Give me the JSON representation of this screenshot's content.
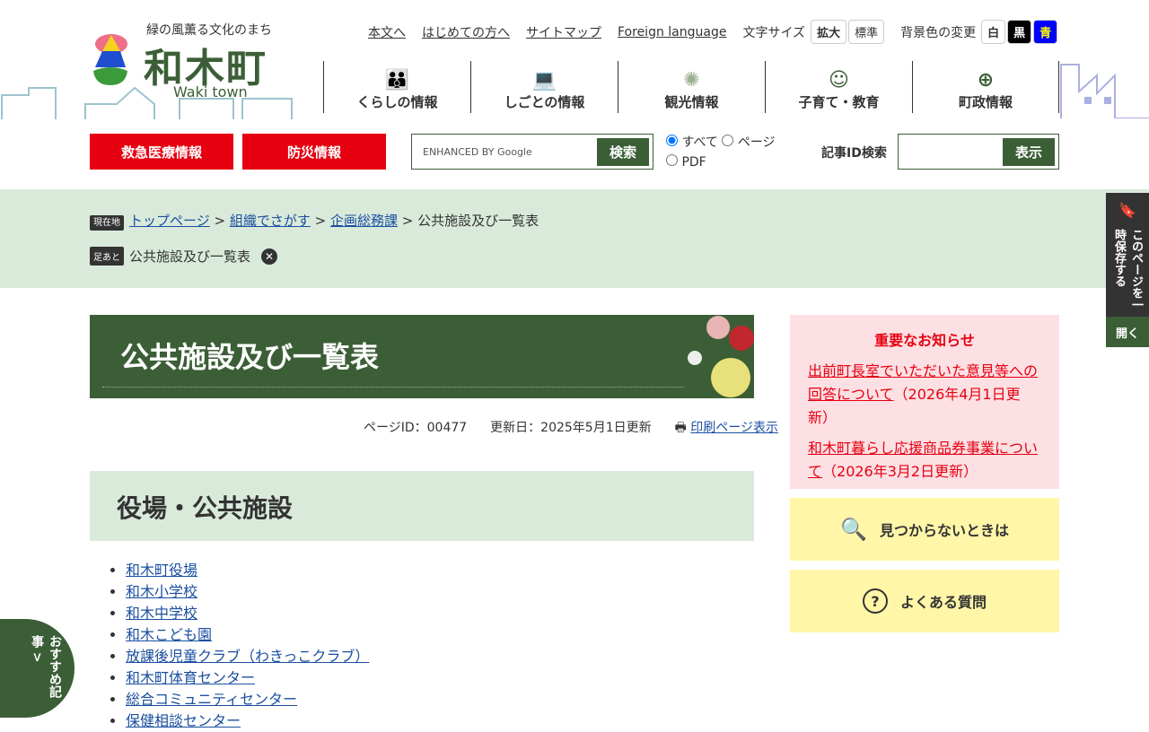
{
  "header": {
    "tagline": "緑の風薫る文化のまち",
    "town_name": "和木町",
    "town_en": "Waki town",
    "links": [
      "本文へ",
      "はじめての方へ",
      "サイトマップ",
      "Foreign language"
    ],
    "font_size_label": "文字サイズ",
    "font_large": "拡大",
    "font_standard": "標準",
    "bg_label": "背景色の変更",
    "bg_white": "白",
    "bg_black": "黒",
    "bg_blue": "青"
  },
  "nav": [
    {
      "label": "くらしの情報",
      "icon": "family-icon"
    },
    {
      "label": "しごとの情報",
      "icon": "work-icon"
    },
    {
      "label": "観光情報",
      "icon": "fireworks-icon"
    },
    {
      "label": "子育て・教育",
      "icon": "child-icon"
    },
    {
      "label": "町政情報",
      "icon": "globe-icon"
    }
  ],
  "emergency": "救急医療情報",
  "disaster": "防災情報",
  "search": {
    "google": "ENHANCED BY Google",
    "button": "検索",
    "opt_all": "すべて",
    "opt_page": "ページ",
    "opt_pdf": "PDF",
    "id_label": "記事ID検索",
    "id_button": "表示"
  },
  "breadcrumb": {
    "tag": "現在地",
    "items": [
      "トップページ",
      "組織でさがす",
      "企画総務課"
    ],
    "current": "公共施設及び一覧表"
  },
  "footprint": {
    "tag": "足あと",
    "item": "公共施設及び一覧表"
  },
  "page": {
    "title": "公共施設及び一覧表",
    "page_id": "ページID：00477",
    "updated": "更新日：2025年5月1日更新",
    "print": "印刷ページ表示",
    "section": "役場・公共施設",
    "list": [
      "和木町役場",
      "和木小学校",
      "和木中学校",
      "和木こども園",
      "放課後児童クラブ（わきっこクラブ）",
      "和木町体育センター",
      "総合コミュニティセンター",
      "保健相談センター"
    ]
  },
  "notice": {
    "title": "重要なお知らせ",
    "items": [
      {
        "link": "出前町長室でいただいた意見等への回答について",
        "date": "（2026年4月1日更新）"
      },
      {
        "link": "和木町暮らし応援商品券事業について",
        "date": "（2026年3月2日更新）"
      }
    ]
  },
  "help": {
    "not_found": "見つからないときは",
    "faq": "よくある質問"
  },
  "side": {
    "save": "このページを一時保存する",
    "open": "開く"
  },
  "recommend": "おすすめ記事 >"
}
